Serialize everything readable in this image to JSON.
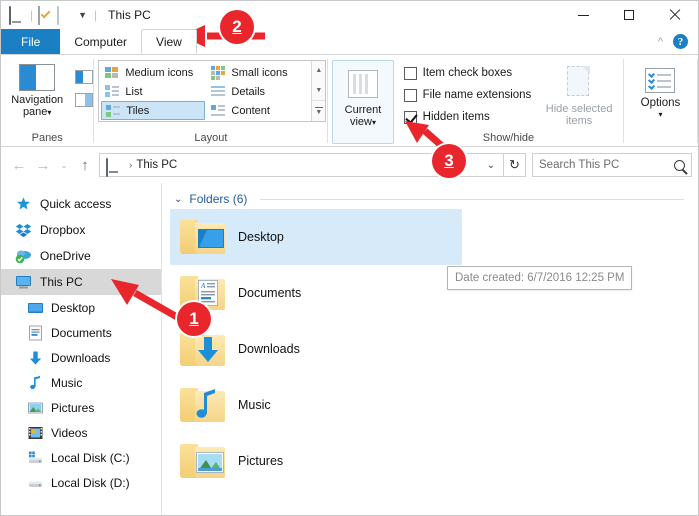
{
  "window": {
    "title": "This PC",
    "quick_access_icons": [
      "this-pc-icon",
      "properties-icon",
      "new-folder-icon",
      "customize-chevron-icon"
    ],
    "controls": {
      "minimize": "–",
      "maximize": "□",
      "close": "✕"
    },
    "ribbon_collapse": "^",
    "help_label": "?"
  },
  "tabs": [
    {
      "id": "file",
      "label": "File"
    },
    {
      "id": "computer",
      "label": "Computer"
    },
    {
      "id": "view",
      "label": "View"
    }
  ],
  "ribbon": {
    "panes": {
      "group_label": "Panes",
      "navigation_pane_label": "Navigation",
      "navigation_pane_label2": "pane",
      "dropdown": "▾",
      "preview_pane": "preview-pane-button",
      "details_pane": "details-pane-button"
    },
    "layout": {
      "group_label": "Layout",
      "items": [
        {
          "label": "Medium icons",
          "selected": false
        },
        {
          "label": "Small icons",
          "selected": false
        },
        {
          "label": "List",
          "selected": false
        },
        {
          "label": "Details",
          "selected": false
        },
        {
          "label": "Tiles",
          "selected": true
        },
        {
          "label": "Content",
          "selected": false
        }
      ],
      "scroll_up": "▲",
      "scroll_down": "▼",
      "more": "▼"
    },
    "current_view": {
      "group_label": "",
      "label_line1": "Current",
      "label_line2": "view",
      "dropdown": "▾"
    },
    "show_hide": {
      "group_label": "Show/hide",
      "checkboxes": [
        {
          "label": "Item check boxes",
          "checked": false
        },
        {
          "label": "File name extensions",
          "checked": false
        },
        {
          "label": "Hidden items",
          "checked": true
        }
      ],
      "hide_selected_line1": "Hide selected",
      "hide_selected_line2": "items"
    },
    "options": {
      "label": "Options",
      "dropdown": "▾"
    }
  },
  "address_bar": {
    "back": "←",
    "forward": "→",
    "recent": "⌄",
    "up": "↑",
    "crumb_icon": "this-pc-icon",
    "crumb": "This PC",
    "crumb_sep": "›",
    "path_dropdown": "⌄",
    "refresh": "↻",
    "search_placeholder": "Search This PC"
  },
  "sidebar": {
    "items": [
      {
        "label": "Quick access",
        "icon": "star-icon",
        "level": 0,
        "selected": false
      },
      {
        "label": "Dropbox",
        "icon": "dropbox-icon",
        "level": 0,
        "selected": false
      },
      {
        "label": "OneDrive",
        "icon": "onedrive-icon",
        "level": 0,
        "selected": false
      },
      {
        "label": "This PC",
        "icon": "this-pc-icon",
        "level": 0,
        "selected": true
      },
      {
        "label": "Desktop",
        "icon": "desktop-icon",
        "level": 1,
        "selected": false
      },
      {
        "label": "Documents",
        "icon": "documents-icon",
        "level": 1,
        "selected": false
      },
      {
        "label": "Downloads",
        "icon": "downloads-icon",
        "level": 1,
        "selected": false
      },
      {
        "label": "Music",
        "icon": "music-icon",
        "level": 1,
        "selected": false
      },
      {
        "label": "Pictures",
        "icon": "pictures-icon",
        "level": 1,
        "selected": false
      },
      {
        "label": "Videos",
        "icon": "videos-icon",
        "level": 1,
        "selected": false
      },
      {
        "label": "Local Disk (C:)",
        "icon": "local-disk-c-icon",
        "level": 1,
        "selected": false
      },
      {
        "label": "Local Disk (D:)",
        "icon": "local-disk-d-icon",
        "level": 1,
        "selected": false
      }
    ]
  },
  "content": {
    "group_chevron": "⌄",
    "group_title": "Folders (6)",
    "tiles": [
      {
        "label": "Desktop",
        "icon": "folder-desktop-icon",
        "selected": true
      },
      {
        "label": "Documents",
        "icon": "folder-documents-icon",
        "selected": false
      },
      {
        "label": "Downloads",
        "icon": "folder-downloads-icon",
        "selected": false
      },
      {
        "label": "Music",
        "icon": "folder-music-icon",
        "selected": false
      },
      {
        "label": "Pictures",
        "icon": "folder-pictures-icon",
        "selected": false
      }
    ],
    "tooltip": "Date created: 6/7/2016 12:25 PM"
  },
  "annotations": [
    {
      "number": "1",
      "target": "this-pc-sidebar-item"
    },
    {
      "number": "2",
      "target": "view-tab"
    },
    {
      "number": "3",
      "target": "hidden-items-checkbox"
    }
  ],
  "colors": {
    "accent": "#1b7fc4",
    "selection": "#d7eaf9",
    "sidebar_selection": "#d8d8d8",
    "annotation_red": "#e8262c",
    "group_header_blue": "#1f5c9e",
    "folder_yellow": "#f6d489"
  }
}
